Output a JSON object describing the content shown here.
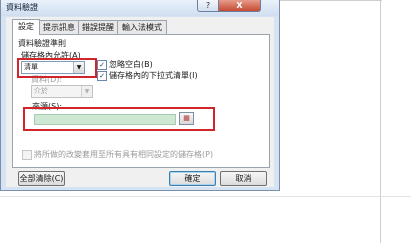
{
  "dialog": {
    "title": "資料驗證",
    "help_glyph": "?",
    "close_glyph": "X"
  },
  "tabs": [
    {
      "label": "設定",
      "active": true
    },
    {
      "label": "提示訊息",
      "active": false
    },
    {
      "label": "錯誤提醒",
      "active": false
    },
    {
      "label": "輸入法模式",
      "active": false
    }
  ],
  "criteria": {
    "group_label": "資料驗證準則",
    "allow_label": "儲存格內允許(A)",
    "allow_value": "清單",
    "data_label": "資料(D):",
    "data_value": "介於",
    "ignore_blank_label": "忽略空白(B)",
    "ignore_blank_checked": true,
    "in_cell_dropdown_label": "儲存格內的下拉式清單(I)",
    "in_cell_dropdown_checked": true,
    "source_label": "來源(S):",
    "source_value": ""
  },
  "apply_all_label": "將所做的改變套用至所有具有相同設定的儲存格(P)",
  "apply_all_checked": false,
  "buttons": {
    "clear_all": "全部清除(C)",
    "ok": "確定",
    "cancel": "取消"
  },
  "icons": {
    "dropdown_arrow": "▼",
    "check_mark": "✓",
    "range_picker": "▦"
  },
  "colors": {
    "highlight_box": "#d0262b",
    "source_field_fill": "#cfe8d4"
  }
}
